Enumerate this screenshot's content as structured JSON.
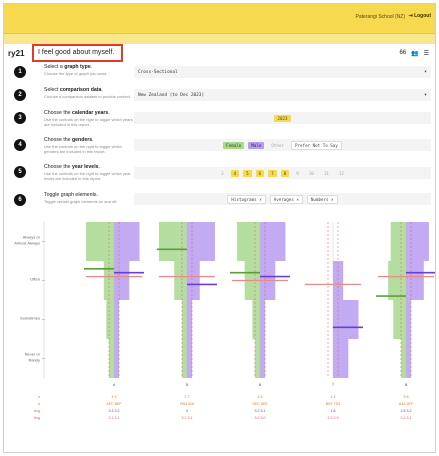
{
  "header": {
    "school": "Paterangi School (NZ)",
    "logout": "Logout"
  },
  "report": {
    "code": "ry21",
    "title": "I feel good about myself.",
    "icons": [
      "66",
      "👥",
      "☰"
    ]
  },
  "steps": [
    {
      "n": "1",
      "pre": "Select a ",
      "bold": "graph type",
      "post": ".",
      "desc": "Choose the type of graph you want."
    },
    {
      "n": "2",
      "pre": "Select ",
      "bold": "comparison data",
      "post": ".",
      "desc": "Choose a comparison dataset to provide context."
    },
    {
      "n": "3",
      "pre": "Choose the ",
      "bold": "calendar years",
      "post": ".",
      "desc": "Use the controls on the right to toggle which years are included in this report."
    },
    {
      "n": "4",
      "pre": "Choose the ",
      "bold": "genders",
      "post": ".",
      "desc": "Use the controls on the right to toggle which genders are included in this report."
    },
    {
      "n": "5",
      "pre": "Choose the ",
      "bold": "year levels",
      "post": ".",
      "desc": "Use the controls on the right to toggle which year levels are included in this report."
    },
    {
      "n": "6",
      "pre": "Toggle graph elements.",
      "bold": "",
      "post": "",
      "desc": "Toggle certain graph elements on and off."
    }
  ],
  "controls": {
    "graph_type": "Cross-Sectional",
    "comparison": "New Zealand (to Dec 2023)",
    "year": "2023",
    "genders": [
      {
        "label": "Female",
        "style": "grn"
      },
      {
        "label": "Male",
        "style": "pur"
      },
      {
        "label": "Other",
        "style": "muted"
      },
      {
        "label": "Prefer Not To Say",
        "style": "plain"
      }
    ],
    "year_levels": [
      {
        "label": "3",
        "on": false
      },
      {
        "label": "4",
        "on": true
      },
      {
        "label": "5",
        "on": true
      },
      {
        "label": "6",
        "on": true
      },
      {
        "label": "7",
        "on": true
      },
      {
        "label": "8",
        "on": true
      },
      {
        "label": "9",
        "on": false
      },
      {
        "label": "10",
        "on": false
      },
      {
        "label": "11",
        "on": false
      },
      {
        "label": "12",
        "on": false
      }
    ],
    "toggles": [
      "Histograms ×",
      "Averages ×",
      "Numbers ×"
    ]
  },
  "chart_data": {
    "type": "histogram",
    "categories_y": [
      "Always or Almost Always",
      "Often",
      "Sometimes",
      "Never or Rarely"
    ],
    "groups": [
      "4",
      "5",
      "6",
      "7",
      "8"
    ],
    "series": [
      {
        "name": "Female",
        "color": "#a9d78f",
        "dist": [
          [
            0.55,
            0.2,
            0.15,
            0.1
          ],
          [
            0.55,
            0.25,
            0.1,
            0.1
          ],
          [
            0.45,
            0.3,
            0.15,
            0.1
          ],
          [
            0.0,
            0.0,
            0.0,
            0.0
          ],
          [
            0.3,
            0.35,
            0.25,
            0.1
          ]
        ],
        "avg": [
          3.3,
          3.8,
          3.2,
          null,
          2.6
        ]
      },
      {
        "name": "Male",
        "color": "#b79cf0",
        "dist": [
          [
            0.5,
            0.3,
            0.1,
            0.1
          ],
          [
            0.55,
            0.25,
            0.1,
            0.1
          ],
          [
            0.5,
            0.3,
            0.1,
            0.1
          ],
          [
            0.0,
            0.2,
            0.5,
            0.3
          ],
          [
            0.45,
            0.35,
            0.1,
            0.1
          ]
        ],
        "avg": [
          3.2,
          2.9,
          3.1,
          1.8,
          3.2
        ]
      }
    ],
    "nz_avg": [
      3.1,
      3.1,
      3.0,
      2.9,
      3.1
    ],
    "n_labels": [
      "4  9",
      "2  7",
      "4  5",
      "1  4",
      "5  8"
    ],
    "sub_labels": [
      "AFC BEF",
      "FAN 526",
      "OEC 6EE",
      "BKF 7A3",
      "A4A 3EF"
    ],
    "row_labels": [
      "n",
      "n",
      "Avg",
      "Avg"
    ],
    "avg_g": [
      "3.3  3.2",
      "3",
      "3.2  3.1",
      "1.8",
      "2.6  3.2"
    ],
    "avg_nz": [
      "3.1  3.1",
      "3.1  3.1",
      "3.0  3.0",
      "2.9  2.9",
      "3.1  3.1"
    ]
  }
}
